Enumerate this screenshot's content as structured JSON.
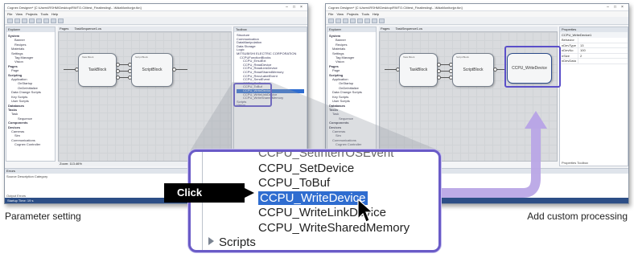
{
  "window": {
    "title": "Cognex Designer* [C:\\Users\\RSHM\\Desktop\\RWTO.Cli\\test_Finaltesting\\...\\MdaMonitorjpr.tkn]",
    "menu": [
      "File",
      "View",
      "Projects",
      "Tools",
      "Help"
    ],
    "explorer_header": "Explorer",
    "page_tab": "Pages",
    "canvas_tab": "TaskSequence1.cs",
    "toolbox_header": "Toolbox",
    "zoom": "Zoom: 113.46%",
    "output_header": "Errors",
    "output_columns": "Source   Description   Category",
    "output_tabs": "Output   Errors",
    "status": "Startup Time: 19 s"
  },
  "explorer_tree": [
    {
      "label": "System",
      "level": 0,
      "group": true
    },
    {
      "label": "Banner",
      "level": 2
    },
    {
      "label": "Recipes",
      "level": 2
    },
    {
      "label": "Materials",
      "level": 1
    },
    {
      "label": "Settings",
      "level": 1
    },
    {
      "label": "Tag Manager",
      "level": 2
    },
    {
      "label": "Vision",
      "level": 2
    },
    {
      "label": "Pages",
      "level": 0,
      "group": true
    },
    {
      "label": "Page",
      "level": 1
    },
    {
      "label": "Scripting",
      "level": 0,
      "group": true
    },
    {
      "label": "Application",
      "level": 1
    },
    {
      "label": "OnStartup",
      "level": 3
    },
    {
      "label": "OnDeInitialize",
      "level": 3
    },
    {
      "label": "Data Change Scripts",
      "level": 1
    },
    {
      "label": "Key Scripts",
      "level": 1
    },
    {
      "label": "User Scripts",
      "level": 1
    },
    {
      "label": "Databases",
      "level": 0,
      "group": true
    },
    {
      "label": "Tasks",
      "level": 0,
      "group": true
    },
    {
      "label": "Task",
      "level": 1
    },
    {
      "label": "Sequence",
      "level": 3
    },
    {
      "label": "Components",
      "level": 0,
      "group": true
    },
    {
      "label": "Devices",
      "level": 0,
      "group": true
    },
    {
      "label": "Cameras",
      "level": 1
    },
    {
      "label": "Sim",
      "level": 2
    },
    {
      "label": "Communications",
      "level": 1
    },
    {
      "label": "Cognex Controller",
      "level": 2
    }
  ],
  "blocks": {
    "task_block": "TaskBlock",
    "script_block": "ScriptBlock",
    "write_device": "CCPU_WriteDevice",
    "task_block_caption": "Task Block",
    "script_block_caption": "Script Block"
  },
  "toolbox_tree": [
    "Structure",
    "Communication",
    "DataManipulation",
    "Data Storage",
    "Logic",
    "MITSUBISHI ELECTRIC CORPORATION",
    "CCPUFunctionBlocks",
    "CCPU_EmulExt",
    "CCPU_ReadDevice",
    "CCPU_ReadLinkDevice",
    "CCPU_ReadSharedMemory",
    "CCPU_RecvLabelEvent",
    "CCPU_SendEvent",
    "CCPU_SetDevice",
    "CCPU_ToBuf",
    "CCPU_WriteDevice",
    "CCPU_WriteLinkDevice",
    "CCPU_WriteSharedMemory",
    "Scripts",
    "Vision"
  ],
  "properties": {
    "header": "Properties",
    "object": "CCPU_WriteDevice1",
    "rows": [
      {
        "k": "Behavior",
        "v": ""
      },
      {
        "k": "nDevType",
        "v": "13"
      },
      {
        "k": "nDevNo",
        "v": "100"
      },
      {
        "k": "nSize",
        "v": "2"
      },
      {
        "k": "nDevData",
        "v": ""
      }
    ],
    "tabs": "Properties   Toolbox"
  },
  "callout": {
    "items": [
      "CCPU_SetInterrOSEvent",
      "CCPU_SetDevice",
      "CCPU_ToBuf",
      "CCPU_WriteDevice",
      "CCPU_WriteLinkDevice",
      "CCPU_WriteSharedMemory"
    ],
    "selected_index": 3,
    "scripts_label": "Scripts"
  },
  "click_label": "Click",
  "captions": {
    "left": "Parameter setting",
    "right": "Add custom processing"
  },
  "colors": {
    "selection": "#2f6dd0",
    "callout_border": "#6a5bc7",
    "arrow": "#b9a6e6"
  }
}
